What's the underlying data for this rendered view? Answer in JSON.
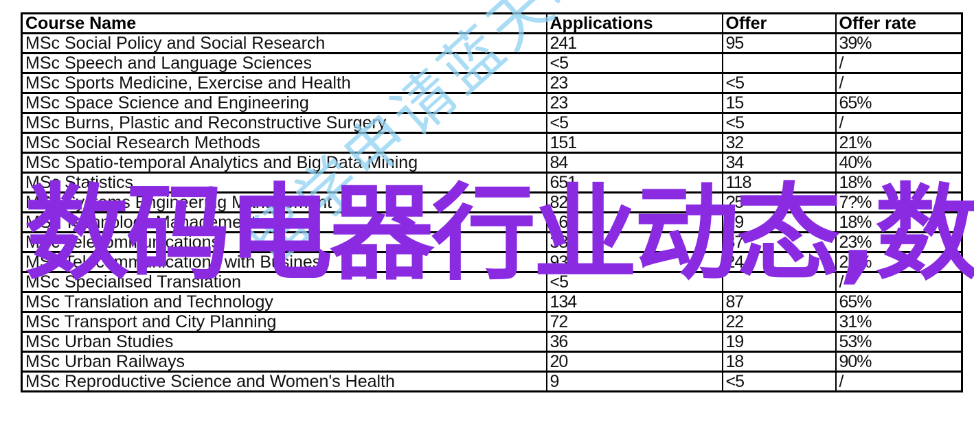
{
  "table": {
    "headers": {
      "course": "Course Name",
      "applications": "Applications",
      "offer": "Offer",
      "offer_rate": "Offer rate"
    },
    "rows": [
      {
        "course": "MSc Social Policy and Social Research",
        "applications": "241",
        "offer": "95",
        "offer_rate": "39%"
      },
      {
        "course": "MSc Speech and Language Sciences",
        "applications": "<5",
        "offer": "",
        "offer_rate": "/"
      },
      {
        "course": "MSc Sports Medicine, Exercise and Health",
        "applications": "23",
        "offer": "<5",
        "offer_rate": "/"
      },
      {
        "course": "MSc Space Science and Engineering",
        "applications": "23",
        "offer": "15",
        "offer_rate": "65%"
      },
      {
        "course": "MSc Burns, Plastic and Reconstructive Surgery",
        "applications": "<5",
        "offer": "<5",
        "offer_rate": "/"
      },
      {
        "course": "MSc Social Research Methods",
        "applications": "151",
        "offer": "32",
        "offer_rate": "21%"
      },
      {
        "course": "MSc Spatio-temporal Analytics and Big Data Mining",
        "applications": "84",
        "offer": "34",
        "offer_rate": "40%"
      },
      {
        "course": "MSc Statistics",
        "applications": "651",
        "offer": "118",
        "offer_rate": "18%"
      },
      {
        "course": "MSc Systems Engineering Management",
        "applications": "82",
        "offer": "?5",
        "offer_rate": "7?%"
      },
      {
        "course": "MSc Technology Management",
        "applications": "160",
        "offer": "29",
        "offer_rate": "18%"
      },
      {
        "course": "MSc Telecommunications",
        "applications": "384",
        "offer": "87",
        "offer_rate": "23%"
      },
      {
        "course": "MSc Telecommunications with Business",
        "applications": "93",
        "offer": "24",
        "offer_rate": "26%"
      },
      {
        "course": "MSc Specialised Translation",
        "applications": "<5",
        "offer": "",
        "offer_rate": "/"
      },
      {
        "course": "MSc Translation and Technology",
        "applications": "134",
        "offer": "87",
        "offer_rate": "65%"
      },
      {
        "course": "MSc Transport and City Planning",
        "applications": "72",
        "offer": "22",
        "offer_rate": "31%"
      },
      {
        "course": "MSc Urban Studies",
        "applications": "36",
        "offer": "19",
        "offer_rate": "53%"
      },
      {
        "course": "MSc Urban Railways",
        "applications": "20",
        "offer": "18",
        "offer_rate": "90%"
      },
      {
        "course": "MSc Reproductive Science and Women's Health",
        "applications": "9",
        "offer": "<5",
        "offer_rate": "/"
      }
    ]
  },
  "watermark": {
    "text": "留学申请蓝天地",
    "color": "#8ed2f2"
  },
  "overlay": {
    "text": "数码电器行业动态,数",
    "color": "#8a2be2"
  }
}
